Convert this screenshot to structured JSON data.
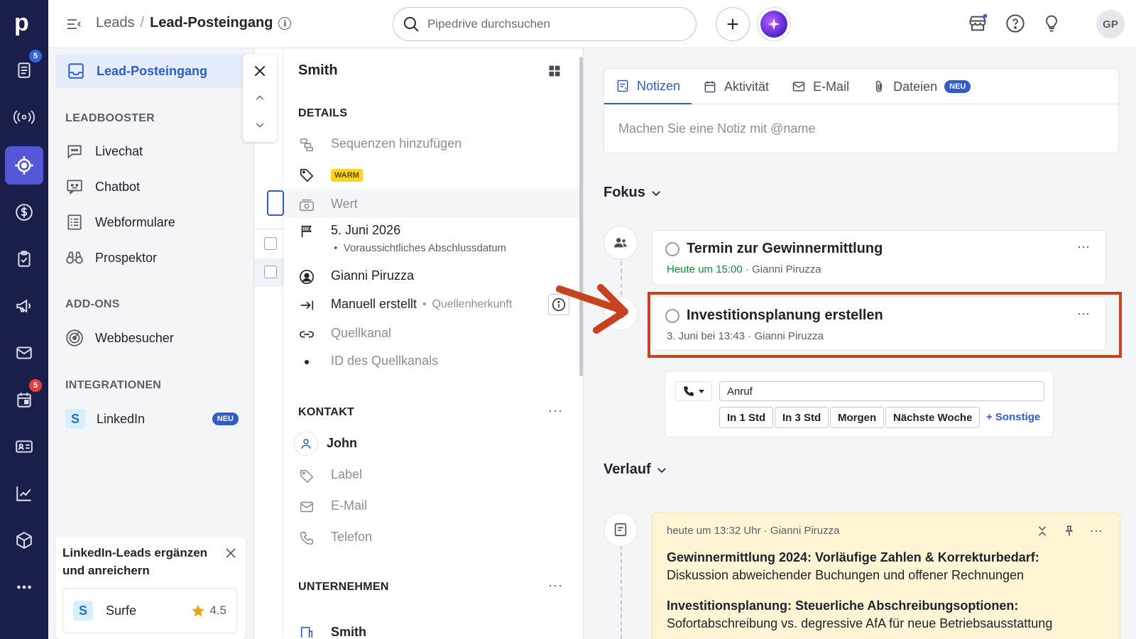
{
  "app": {
    "logo": "p"
  },
  "rail": {
    "badges": {
      "leads": "5",
      "activities": "5"
    },
    "items": [
      "leads-icon",
      "broadcast-icon",
      "target-icon",
      "dollar-icon",
      "checklist-icon",
      "megaphone-icon",
      "mail-icon",
      "calendar-icon",
      "contacts-icon",
      "chart-icon",
      "box-icon",
      "more-icon"
    ]
  },
  "topbar": {
    "breadcrumb_root": "Leads",
    "breadcrumb_sep": "/",
    "breadcrumb_current": "Lead-Posteingang",
    "info": "i",
    "search_placeholder": "Pipedrive durchsuchen",
    "avatar": "GP"
  },
  "sidebar": {
    "active": "Lead-Posteingang",
    "leadbooster": "LEADBOOSTER",
    "items_leadbooster": [
      "Livechat",
      "Chatbot",
      "Webformulare",
      "Prospektor"
    ],
    "addons": "ADD-ONS",
    "items_addons": [
      "Webbesucher"
    ],
    "integrations": "INTEGRATIONEN",
    "linkedin": "LinkedIn",
    "neu": "NEU",
    "promo_title": "LinkedIn-Leads ergänzen und anreichern",
    "promo_app": "Surfe",
    "promo_logo": "S",
    "promo_rating": "4.5"
  },
  "detail": {
    "title": "Smith",
    "details_h": "DETAILS",
    "sequences": "Sequenzen hinzufügen",
    "tag": "WARM",
    "value": "Wert",
    "close_date": "5. Juni 2026",
    "close_date_label": "Voraussichtliches Abschlussdatum",
    "owner": "Gianni Piruzza",
    "source_origin": "Manuell erstellt",
    "source_origin_label": "Quellenherkunft",
    "source_channel": "Quellkanal",
    "source_channel_id": "ID des Quellkanals",
    "contact_h": "KONTAKT",
    "contact_name": "John",
    "label": "Label",
    "email": "E-Mail",
    "phone": "Telefon",
    "company_h": "UNTERNEHMEN",
    "company_name": "Smith",
    "dots": "···"
  },
  "composer": {
    "tabs": [
      "Notizen",
      "Aktivität",
      "E-Mail",
      "Dateien"
    ],
    "tab_badge": "NEU",
    "placeholder": "Machen Sie eine Notiz mit @name"
  },
  "focus": {
    "heading": "Fokus",
    "activities": [
      {
        "title": "Termin zur Gewinnermittlung",
        "when": "Heute um 15:00",
        "sep": "·",
        "owner": "Gianni Piruzza"
      },
      {
        "title": "Investitionsplanung erstellen",
        "when": "3. Juni bei 13:43",
        "sep": "·",
        "owner": "Gianni Piruzza"
      }
    ],
    "call_value": "Anruf",
    "quick": [
      "In 1 Std",
      "In 3 Std",
      "Morgen",
      "Nächste Woche"
    ],
    "other": "+ Sonstige"
  },
  "history": {
    "heading": "Verlauf",
    "note_meta": "heute um 13:32 Uhr · Gianni Piruzza",
    "p1_bold": "Gewinnermittlung 2024: Vorläufige Zahlen & Korrekturbedarf:",
    "p1_text": " Diskussion abweichender Buchungen und offener Rechnungen",
    "p2_bold": "Investitionsplanung: Steuerliche Abschreibungsoptionen:",
    "p2_text": " Sofortabschreibung vs. degressive AfA für neue Betriebsausstattung"
  },
  "colors": {
    "rail": "#1a1e4a",
    "accent": "#2f5cc9",
    "highlight": "#c7421f",
    "note": "#fff4d4",
    "warm": "#ffd61f"
  }
}
